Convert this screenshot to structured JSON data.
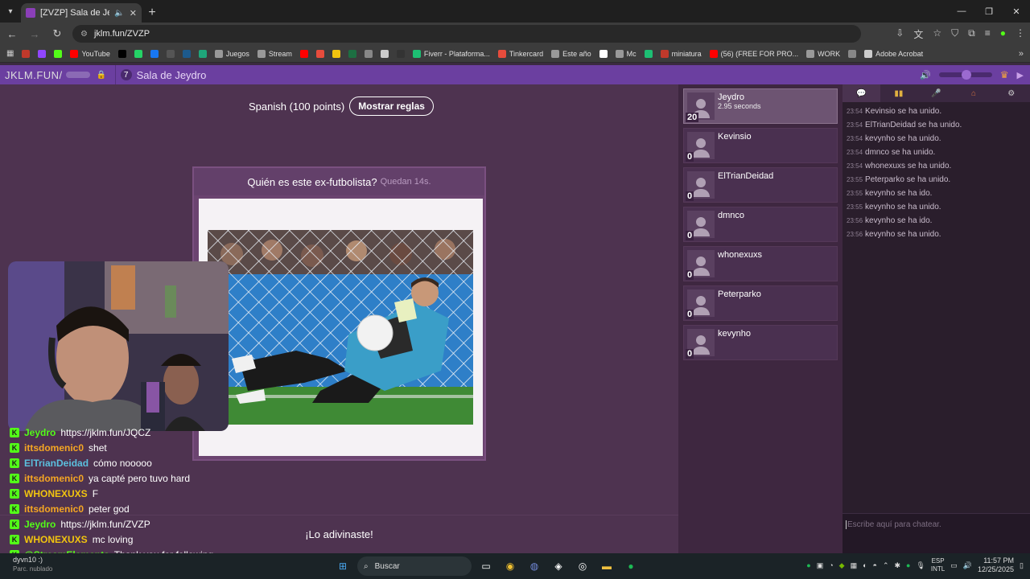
{
  "browser": {
    "tab_title": "[ZVZP] Sala de Jeydro",
    "url": "jklm.fun/ZVZP",
    "bookmarks": [
      {
        "label": "",
        "color": "#c0392b"
      },
      {
        "label": "",
        "color": "#9146ff"
      },
      {
        "label": "",
        "color": "#53fc18"
      },
      {
        "label": "YouTube",
        "color": "#ff0000"
      },
      {
        "label": "",
        "color": "#000000"
      },
      {
        "label": "",
        "color": "#25d366"
      },
      {
        "label": "",
        "color": "#1877f2"
      },
      {
        "label": "",
        "color": "#555555"
      },
      {
        "label": "",
        "color": "#1d5a8c"
      },
      {
        "label": "",
        "color": "#1fa67a"
      },
      {
        "label": "Juegos",
        "color": "#999999"
      },
      {
        "label": "Stream",
        "color": "#999999"
      },
      {
        "label": "",
        "color": "#ff0000"
      },
      {
        "label": "",
        "color": "#e74c3c"
      },
      {
        "label": "",
        "color": "#f1c40f"
      },
      {
        "label": "",
        "color": "#1d6f42"
      },
      {
        "label": "",
        "color": "#888888"
      },
      {
        "label": "",
        "color": "#cccccc"
      },
      {
        "label": "",
        "color": "#333333"
      },
      {
        "label": "Fiverr - Plataforma...",
        "color": "#1dbf73"
      },
      {
        "label": "Tinkercard",
        "color": "#e74c3c"
      },
      {
        "label": "Este año",
        "color": "#999999"
      },
      {
        "label": "",
        "color": "#ffffff"
      },
      {
        "label": "Mc",
        "color": "#999999"
      },
      {
        "label": "",
        "color": "#1dbf73"
      },
      {
        "label": "miniatura",
        "color": "#c0392b"
      },
      {
        "label": "(56) (FREE FOR PRO...",
        "color": "#ff0000"
      },
      {
        "label": "WORK",
        "color": "#999999"
      },
      {
        "label": "",
        "color": "#888888"
      },
      {
        "label": "Adobe Acrobat",
        "color": "#cccccc"
      }
    ]
  },
  "site": {
    "brand": "JKLM.FUN/",
    "room_number": "7",
    "room_name": "Sala de Jeydro"
  },
  "game": {
    "language_label": "Spanish (100 points)",
    "rules_button": "Mostrar reglas",
    "question": "Quién es este ex-futbolista?",
    "timer": "Quedan 14s.",
    "guess_status": "¡Lo adivinaste!"
  },
  "players": [
    {
      "name": "Jeydro",
      "score": "20",
      "time": "2.95 seconds",
      "active": true
    },
    {
      "name": "Kevinsio",
      "score": "0",
      "time": "",
      "active": false
    },
    {
      "name": "ElTrianDeidad",
      "score": "0",
      "time": "",
      "active": false
    },
    {
      "name": "dmnco",
      "score": "0",
      "time": "",
      "active": false
    },
    {
      "name": "whonexuxs",
      "score": "0",
      "time": "",
      "active": false
    },
    {
      "name": "Peterparko",
      "score": "0",
      "time": "",
      "active": false
    },
    {
      "name": "kevynho",
      "score": "0",
      "time": "",
      "active": false
    }
  ],
  "side_chat": {
    "log": [
      {
        "time": "23:54",
        "text": "Kevinsio se ha unido."
      },
      {
        "time": "23:54",
        "text": "ElTrianDeidad  se ha unido."
      },
      {
        "time": "23:54",
        "text": "kevynho se ha unido."
      },
      {
        "time": "23:54",
        "text": "dmnco se ha unido."
      },
      {
        "time": "23:54",
        "text": "whonexuxs se ha unido."
      },
      {
        "time": "23:55",
        "text": "Peterparko se ha unido."
      },
      {
        "time": "23:55",
        "text": "kevynho se ha ido."
      },
      {
        "time": "23:55",
        "text": "kevynho se ha unido."
      },
      {
        "time": "23:56",
        "text": "kevynho se ha ido."
      },
      {
        "time": "23:56",
        "text": "kevynho se ha unido."
      }
    ],
    "input_placeholder": "Escribe aquí para chatear."
  },
  "stream_chat": [
    {
      "user": "Jeydro",
      "color": "#53fc18",
      "text": "https://jklm.fun/JQCZ"
    },
    {
      "user": "ittsdomenic0",
      "color": "#f5a623",
      "text": "shet"
    },
    {
      "user": "ElTrianDeidad",
      "color": "#5bc0de",
      "text": "cómo nooooo"
    },
    {
      "user": "ittsdomenic0",
      "color": "#f5a623",
      "text": "ya capté pero tuvo hard"
    },
    {
      "user": "WHONEXUXS",
      "color": "#f1c40f",
      "text": "F"
    },
    {
      "user": "ittsdomenic0",
      "color": "#f5a623",
      "text": "peter god"
    },
    {
      "user": "Jeydro",
      "color": "#53fc18",
      "text": "https://jklm.fun/ZVZP"
    },
    {
      "user": "WHONEXUXS",
      "color": "#f1c40f",
      "text": "mc loving"
    },
    {
      "user": "@StreamElements",
      "color": "#53fc18",
      "text": "Thank you for following"
    }
  ],
  "taskbar": {
    "weather_line1": "dyvn10 :)",
    "weather_line2": "Parc. nublado",
    "search_label": "Buscar",
    "lang_top": "ESP",
    "lang_bottom": "INTL",
    "time": "11:57 PM",
    "date": "12/25/2025"
  }
}
